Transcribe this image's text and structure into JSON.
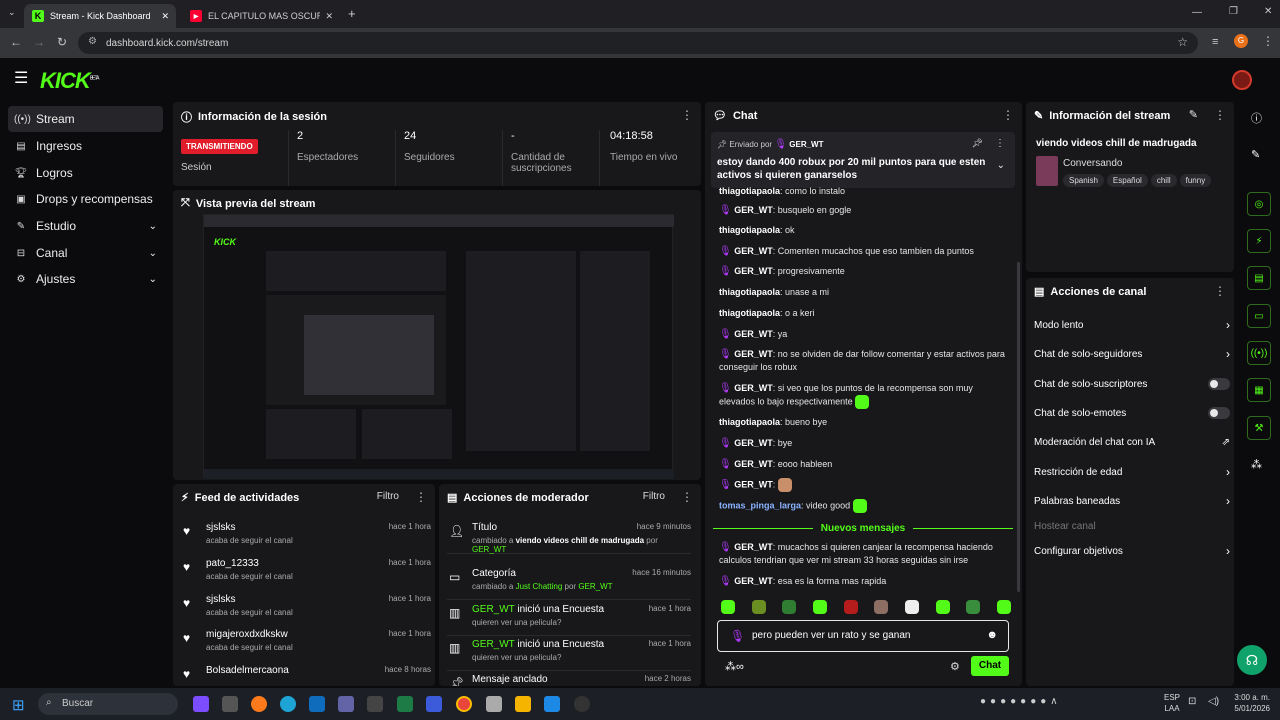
{
  "browser": {
    "tabs": [
      {
        "title": "Stream - Kick Dashboard",
        "active": true
      },
      {
        "title": "EL CAPITULO MAS OSCURO DE",
        "active": false
      }
    ],
    "url": "dashboard.kick.com/stream",
    "new_tab": "+"
  },
  "brand": {
    "logo": "KICK",
    "beta": "BETA",
    "accent": "#53fc18"
  },
  "sidebar": {
    "items": [
      {
        "label": "Stream",
        "icon": "stream-icon",
        "selected": true
      },
      {
        "label": "Ingresos",
        "icon": "wallet-icon"
      },
      {
        "label": "Logros",
        "icon": "trophy-icon"
      },
      {
        "label": "Drops y recompensas",
        "icon": "gift-icon"
      },
      {
        "label": "Estudio",
        "icon": "pen-icon",
        "expandable": true
      },
      {
        "label": "Canal",
        "icon": "channel-icon",
        "expandable": true
      },
      {
        "label": "Ajustes",
        "icon": "gear-icon",
        "expandable": true
      }
    ]
  },
  "session": {
    "title": "Información de la sesión",
    "live_badge": "TRANSMITIENDO",
    "session_label": "Sesión",
    "stats": [
      {
        "value": "2",
        "label": "Espectadores"
      },
      {
        "value": "24",
        "label": "Seguidores"
      },
      {
        "value": "-",
        "label": "Cantidad de suscripciones"
      },
      {
        "value": "04:18:58",
        "label": "Tiempo en vivo"
      }
    ]
  },
  "preview": {
    "title": "Vista previa del stream"
  },
  "feed": {
    "title": "Feed de actividades",
    "filter": "Filtro",
    "items": [
      {
        "name": "sjslsks",
        "sub": "acaba de seguir el canal",
        "time": "hace 1 hora"
      },
      {
        "name": "pato_12333",
        "sub": "acaba de seguir el canal",
        "time": "hace 1 hora"
      },
      {
        "name": "sjslsks",
        "sub": "acaba de seguir el canal",
        "time": "hace 1 hora"
      },
      {
        "name": "migajeroxdxdkskw",
        "sub": "acaba de seguir el canal",
        "time": "hace 1 hora"
      },
      {
        "name": "Bolsadelmercaona",
        "sub": "",
        "time": "hace 8 horas"
      }
    ]
  },
  "modactions": {
    "title": "Acciones de moderador",
    "filter": "Filtro",
    "items": [
      {
        "name": "Título",
        "sub_a": "cambiado a ",
        "sub_b": "viendo videos chill de madrugada",
        "sub_c": " por ",
        "sub_user": "GER_WT",
        "time": "hace 9 minutos",
        "icon": "user-edit-icon"
      },
      {
        "name": "Categoría",
        "sub_a": "cambiado a ",
        "sub_b": "Just Chatting",
        "sub_c": " por ",
        "sub_user": "GER_WT",
        "time": "hace 16 minutos",
        "icon": "category-icon"
      },
      {
        "name_user": "GER_WT",
        "name_rest": " inició una Encuesta",
        "sub_a": "quieren ver una pelicula?",
        "time": "hace 1 hora",
        "icon": "poll-icon"
      },
      {
        "name_user": "GER_WT",
        "name_rest": " inició una Encuesta",
        "sub_a": "quieren ver una pelicula?",
        "time": "hace 1 hora",
        "icon": "poll-icon"
      },
      {
        "name": "Mensaje anclado",
        "time": "hace 2 horas",
        "icon": "pin-icon"
      }
    ]
  },
  "chat": {
    "title": "Chat",
    "pinned_by": "Enviado por",
    "pinned_user": "GER_WT",
    "pinned_text": "estoy dando 400 robux por 20 mil puntos para que esten activos si quieren ganarselos",
    "messages": [
      {
        "user": "thiagotiapaola",
        "text": "como lo instalo",
        "mic": false
      },
      {
        "user": "GER_WT",
        "text": "busquelo en gogle",
        "mic": true
      },
      {
        "user": "thiagotiapaola",
        "text": "ok",
        "mic": false
      },
      {
        "user": "GER_WT",
        "text": "Comenten mucachos que eso tambien da puntos",
        "mic": true
      },
      {
        "user": "GER_WT",
        "text": "progresivamente",
        "mic": true
      },
      {
        "user": "thiagotiapaola",
        "text": "unase a mi",
        "mic": false
      },
      {
        "user": "thiagotiapaola",
        "text": "o a keri",
        "mic": false
      },
      {
        "user": "GER_WT",
        "text": "ya",
        "mic": true
      },
      {
        "user": "GER_WT",
        "text": "no se olviden de dar follow comentar y estar activos para conseguir los robux",
        "mic": true
      },
      {
        "user": "GER_WT",
        "text": "si veo que los puntos de la recompensa son muy elevados lo bajo respectivamente",
        "mic": true
      },
      {
        "user": "thiagotiapaola",
        "text": "bueno bye",
        "mic": false
      },
      {
        "user": "GER_WT",
        "text": "bye",
        "mic": true
      },
      {
        "user": "GER_WT",
        "text": "eooo hableen",
        "mic": true
      },
      {
        "user": "GER_WT",
        "text": "",
        "mic": true
      },
      {
        "user": "tomas_pinga_larga",
        "text": "video good",
        "mic": false
      }
    ],
    "new_messages": "Nuevos mensajes",
    "new": [
      {
        "user": "GER_WT",
        "text": "mucachos si quieren canjear la recompensa haciendo calculos tendrian que ver mi stream 33 horas seguidas sin irse"
      },
      {
        "user": "GER_WT",
        "text": "esa es la forma mas rapida"
      }
    ],
    "input_value": "pero pueden ver un rato y se ganan",
    "send": "Chat"
  },
  "streaminfo": {
    "title": "Información del stream",
    "stream_title": "viendo videos chill de madrugada",
    "category": "Conversando",
    "tags": [
      "Spanish",
      "Español",
      "chill",
      "funny"
    ]
  },
  "channel_actions": {
    "title": "Acciones de canal",
    "items": [
      {
        "label": "Modo lento",
        "control": "chevron"
      },
      {
        "label": "Chat de solo-seguidores",
        "control": "chevron"
      },
      {
        "label": "Chat de solo-suscriptores",
        "control": "toggle"
      },
      {
        "label": "Chat de solo-emotes",
        "control": "toggle"
      },
      {
        "label": "Moderación del chat con IA",
        "control": "external"
      },
      {
        "label": "Restricción de edad",
        "control": "chevron"
      },
      {
        "label": "Palabras baneadas",
        "control": "chevron"
      },
      {
        "label": "Hostear canal",
        "control": "none",
        "disabled": true
      },
      {
        "label": "Configurar objetivos",
        "control": "chevron"
      }
    ]
  },
  "taskbar": {
    "search": "Buscar",
    "lang": "ESP",
    "lang2": "LAA",
    "time": "3:00 a. m.",
    "date": "5/01/2026"
  }
}
